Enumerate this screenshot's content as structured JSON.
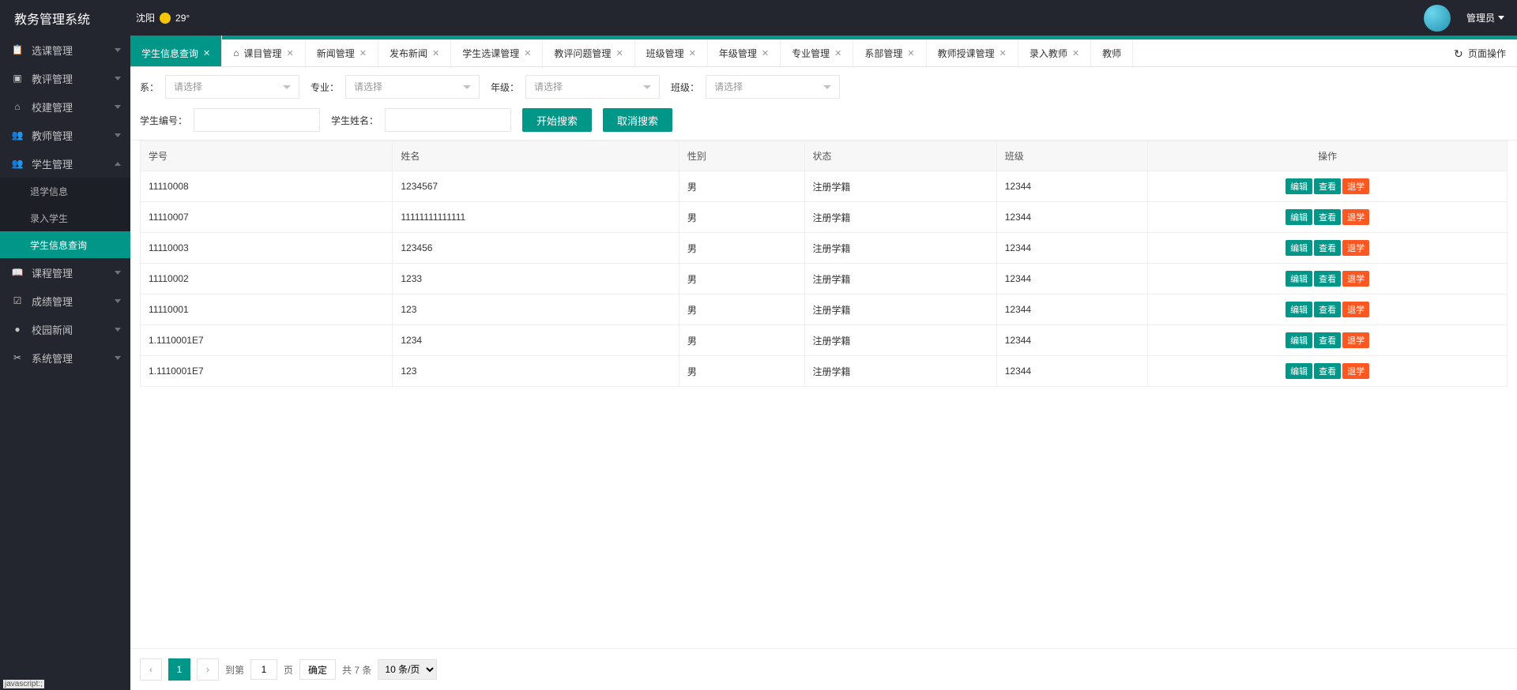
{
  "header": {
    "title": "教务管理系统",
    "weather_city": "沈阳",
    "weather_temp": "29°",
    "user_label": "管理员"
  },
  "sidebar": [
    {
      "icon": "📋",
      "label": "选课管理",
      "expanded": false
    },
    {
      "icon": "▣",
      "label": "教评管理",
      "expanded": false
    },
    {
      "icon": "⌂",
      "label": "校建管理",
      "expanded": false
    },
    {
      "icon": "👥",
      "label": "教师管理",
      "expanded": false
    },
    {
      "icon": "👥",
      "label": "学生管理",
      "expanded": true,
      "children": [
        {
          "label": "退学信息",
          "active": false
        },
        {
          "label": "录入学生",
          "active": false
        },
        {
          "label": "学生信息查询",
          "active": true
        }
      ]
    },
    {
      "icon": "📖",
      "label": "课程管理",
      "expanded": false
    },
    {
      "icon": "☑",
      "label": "成绩管理",
      "expanded": false
    },
    {
      "icon": "●",
      "label": "校园新闻",
      "expanded": false
    },
    {
      "icon": "✂",
      "label": "系统管理",
      "expanded": false
    }
  ],
  "tabs": [
    {
      "label": "学生信息查询",
      "active": true,
      "closable": true
    },
    {
      "label": "课目管理",
      "active": false,
      "closable": true,
      "home": true
    },
    {
      "label": "新闻管理",
      "active": false,
      "closable": true
    },
    {
      "label": "发布新闻",
      "active": false,
      "closable": true
    },
    {
      "label": "学生选课管理",
      "active": false,
      "closable": true
    },
    {
      "label": "教评问题管理",
      "active": false,
      "closable": true
    },
    {
      "label": "班级管理",
      "active": false,
      "closable": true
    },
    {
      "label": "年级管理",
      "active": false,
      "closable": true
    },
    {
      "label": "专业管理",
      "active": false,
      "closable": true
    },
    {
      "label": "系部管理",
      "active": false,
      "closable": true
    },
    {
      "label": "教师授课管理",
      "active": false,
      "closable": true
    },
    {
      "label": "录入教师",
      "active": false,
      "closable": true
    },
    {
      "label": "教师",
      "active": false,
      "closable": false
    }
  ],
  "page_ops_label": "页面操作",
  "filters": {
    "dept_label": "系：",
    "major_label": "专业：",
    "grade_label": "年级：",
    "class_label": "班级：",
    "placeholder": "请选择",
    "stu_no_label": "学生编号：",
    "stu_name_label": "学生姓名：",
    "search_btn": "开始搜索",
    "cancel_btn": "取消搜索"
  },
  "table": {
    "columns": [
      "学号",
      "姓名",
      "性别",
      "状态",
      "班级",
      "操作"
    ],
    "action_labels": {
      "edit": "编辑",
      "view": "查看",
      "quit": "退学"
    },
    "rows": [
      {
        "id": "11110008",
        "name": "1234567",
        "gender": "男",
        "status": "注册学籍",
        "class": "12344"
      },
      {
        "id": "11110007",
        "name": "11111111111111",
        "gender": "男",
        "status": "注册学籍",
        "class": "12344"
      },
      {
        "id": "11110003",
        "name": "123456",
        "gender": "男",
        "status": "注册学籍",
        "class": "12344"
      },
      {
        "id": "11110002",
        "name": "1233",
        "gender": "男",
        "status": "注册学籍",
        "class": "12344"
      },
      {
        "id": "11110001",
        "name": "123",
        "gender": "男",
        "status": "注册学籍",
        "class": "12344"
      },
      {
        "id": "1.1110001E7",
        "name": "1234",
        "gender": "男",
        "status": "注册学籍",
        "class": "12344"
      },
      {
        "id": "1.1110001E7",
        "name": "123",
        "gender": "男",
        "status": "注册学籍",
        "class": "12344"
      }
    ]
  },
  "pagination": {
    "current": "1",
    "goto_label": "到第",
    "page_suffix": "页",
    "confirm": "确定",
    "total": "共 7 条",
    "per_page": "10 条/页"
  },
  "status_text": "javascript:;"
}
